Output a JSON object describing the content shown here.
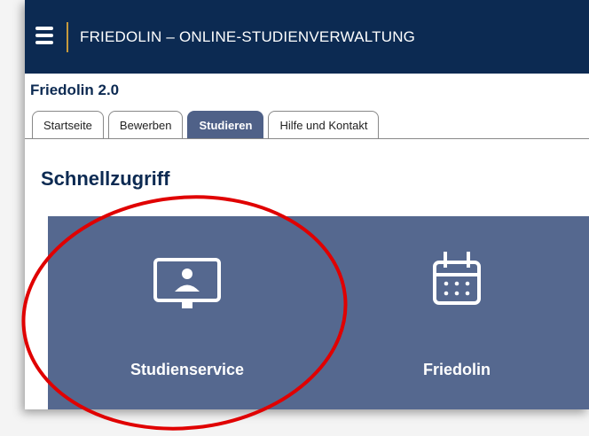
{
  "header": {
    "title": "FRIEDOLIN – ONLINE-STUDIENVERWALTUNG",
    "menu_icon": "hamburger-menu-icon",
    "background_color": "#0c2a52",
    "accent_color": "#c79a3d"
  },
  "subheader": {
    "title": "Friedolin 2.0"
  },
  "tabs": [
    {
      "label": "Startseite",
      "active": false
    },
    {
      "label": "Bewerben",
      "active": false
    },
    {
      "label": "Studieren",
      "active": true
    },
    {
      "label": "Hilfe und Kontakt",
      "active": false
    }
  ],
  "section": {
    "title": "Schnellzugriff"
  },
  "tiles": [
    {
      "label": "Studienservice",
      "icon": "monitor-user-icon"
    },
    {
      "label": "Friedolin",
      "icon": "calendar-icon"
    }
  ],
  "colors": {
    "tile": "#55688f",
    "active_tab": "#4f6188",
    "highlight": "#e00000"
  }
}
